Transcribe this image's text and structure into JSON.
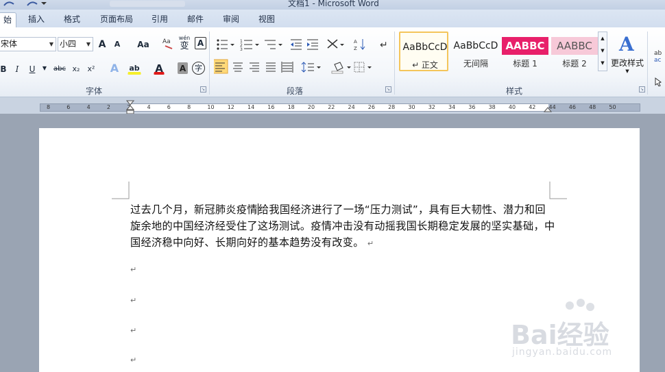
{
  "window": {
    "title": "文档1 - Microsoft Word"
  },
  "tabs": [
    {
      "label": "始"
    },
    {
      "label": "插入"
    },
    {
      "label": "格式"
    },
    {
      "label": "页面布局"
    },
    {
      "label": "引用"
    },
    {
      "label": "邮件"
    },
    {
      "label": "审阅"
    },
    {
      "label": "视图"
    }
  ],
  "font_group": {
    "label": "字体",
    "font_name": "宋体",
    "font_size": "小四",
    "grow_label": "A",
    "shrink_label": "A",
    "case_label": "Aa",
    "phonetic_label": "wén",
    "phonetic_char": "变",
    "border_char": "A",
    "bold": "B",
    "italic": "I",
    "underline": "U",
    "strike": "abc",
    "subscript": "x₂",
    "superscript": "x²",
    "text_effect": "A",
    "highlight": "ab",
    "font_color": "A",
    "char_shading": "A",
    "enclosed_char": "字"
  },
  "paragraph_group": {
    "label": "段落"
  },
  "styles_group": {
    "label": "样式",
    "change_styles_label": "更改样式",
    "items": [
      {
        "preview": "AaBbCcD",
        "name": "↵ 正文"
      },
      {
        "preview": "AaBbCcD",
        "name": "无间隔"
      },
      {
        "preview": "AABBC",
        "name": "标题 1"
      },
      {
        "preview": "AABBC",
        "name": "标题 2"
      }
    ]
  },
  "ruler": {
    "numbers": [
      "8",
      "6",
      "4",
      "2",
      "2",
      "4",
      "6",
      "8",
      "10",
      "12",
      "14",
      "16",
      "18",
      "20",
      "22",
      "24",
      "26",
      "28",
      "30",
      "32",
      "34",
      "36",
      "38",
      "40",
      "42",
      "44",
      "46",
      "48",
      "50"
    ]
  },
  "document": {
    "paragraph_before_cursor": "过去几个月，新冠肺炎疫情",
    "paragraph_after_cursor": "给我国经济进行了一场“压力测试”，具有巨大韧性、潜力和回旋余地的中国经济经受住了这场测试。疫情冲击没有动摇我国长期稳定发展的坚实基础，中国经济稳中向好、长期向好的基本趋势没有改变。",
    "paragraph_mark": "↵"
  },
  "watermark": {
    "brand": "Bai经验",
    "url": "jingyan.baidu.com"
  },
  "colors": {
    "highlight_box": "#e31b1b",
    "heading1_bg": "#e8206a",
    "heading2_bg": "#f7c9d8"
  }
}
